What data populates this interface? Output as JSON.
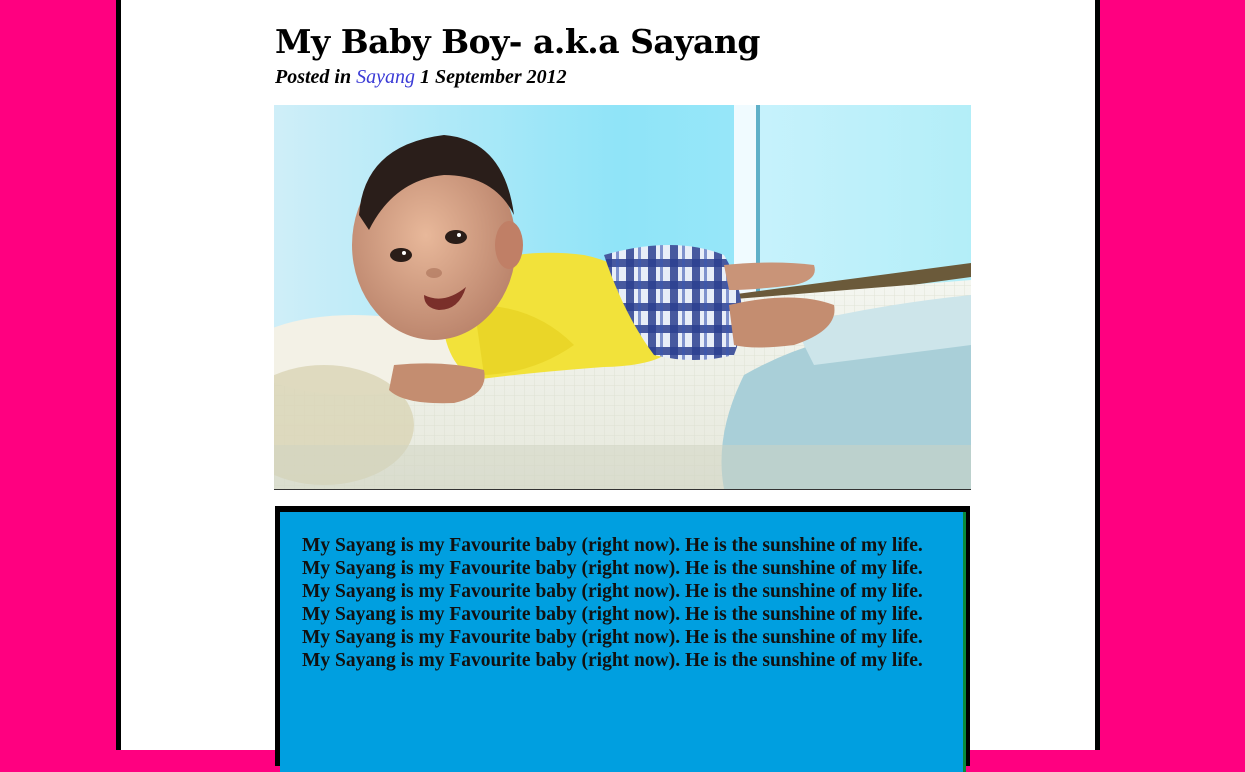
{
  "post": {
    "title": "My Baby Boy- a.k.a Sayang",
    "meta": {
      "posted_in_label": "Posted in",
      "category_link": "Sayang",
      "date": "1 September 2012"
    },
    "image": {
      "alt": "Baby boy in yellow shirt and plaid shorts lying on a bed"
    },
    "body": "My Sayang is my Favourite baby (right now). He is the sunshine of my life. My Sayang is my Favourite baby (right now). He is the sunshine of my life. My Sayang is my Favourite baby (right now). He is the sunshine of my life. My Sayang is my Favourite baby (right now). He is the sunshine of my life. My Sayang is my Favourite baby (right now). He is the sunshine of my life. My Sayang is my Favourite baby (right now). He is the sunshine of my life."
  },
  "colors": {
    "page_background": "#ff0080",
    "content_box": "#009fe0",
    "link": "#3b3bd6"
  }
}
